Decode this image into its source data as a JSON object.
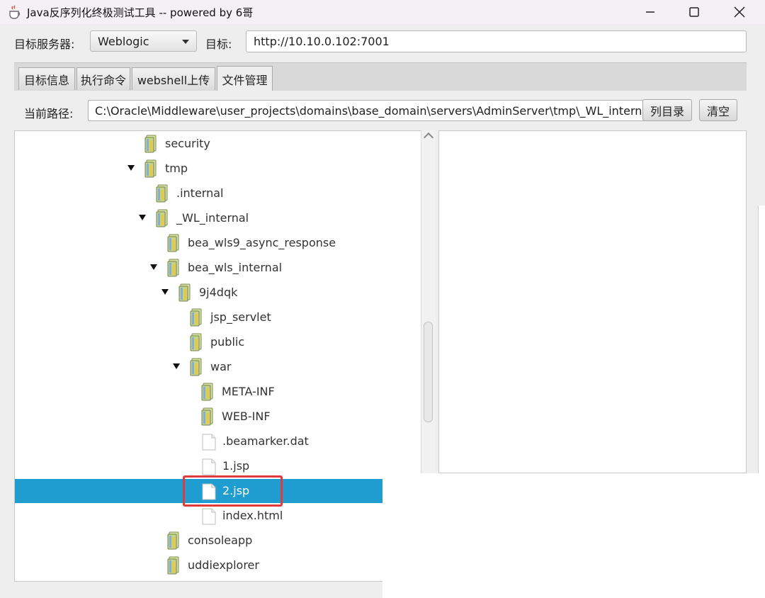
{
  "window": {
    "title": "Java反序列化终极测试工具  -- powered by 6哥"
  },
  "toolbar": {
    "server_label": "目标服务器:",
    "server_value": "Weblogic",
    "target_label": "目标:",
    "target_value": "http://10.10.0.102:7001"
  },
  "tabs": [
    {
      "label": "目标信息",
      "active": false
    },
    {
      "label": "执行命令",
      "active": false
    },
    {
      "label": "webshell上传",
      "active": false
    },
    {
      "label": "文件管理",
      "active": true
    }
  ],
  "file_manager": {
    "path_label": "当前路径:",
    "path_value": "C:\\Oracle\\Middleware\\user_projects\\domains\\base_domain\\servers\\AdminServer\\tmp\\_WL_internal",
    "list_button": "列目录",
    "clear_button": "清空"
  },
  "tree": [
    {
      "label": "security",
      "type": "folder",
      "depth": 0,
      "expanded": false
    },
    {
      "label": "tmp",
      "type": "folder",
      "depth": 0,
      "expanded": true
    },
    {
      "label": ".internal",
      "type": "folder",
      "depth": 1,
      "expanded": false
    },
    {
      "label": "_WL_internal",
      "type": "folder",
      "depth": 1,
      "expanded": true
    },
    {
      "label": "bea_wls9_async_response",
      "type": "folder",
      "depth": 2,
      "expanded": false
    },
    {
      "label": "bea_wls_internal",
      "type": "folder",
      "depth": 2,
      "expanded": true
    },
    {
      "label": "9j4dqk",
      "type": "folder",
      "depth": 3,
      "expanded": true
    },
    {
      "label": "jsp_servlet",
      "type": "folder",
      "depth": 4,
      "expanded": false
    },
    {
      "label": "public",
      "type": "folder",
      "depth": 4,
      "expanded": false
    },
    {
      "label": "war",
      "type": "folder",
      "depth": 4,
      "expanded": true
    },
    {
      "label": "META-INF",
      "type": "folder",
      "depth": 5,
      "expanded": false
    },
    {
      "label": "WEB-INF",
      "type": "folder",
      "depth": 5,
      "expanded": false
    },
    {
      "label": ".beamarker.dat",
      "type": "file",
      "depth": 5,
      "expanded": false
    },
    {
      "label": "1.jsp",
      "type": "file",
      "depth": 5,
      "expanded": false
    },
    {
      "label": "2.jsp",
      "type": "file",
      "depth": 5,
      "expanded": false,
      "selected": true
    },
    {
      "label": "index.html",
      "type": "file",
      "depth": 5,
      "expanded": false
    },
    {
      "label": "consoleapp",
      "type": "folder",
      "depth": 2,
      "expanded": false
    },
    {
      "label": "uddiexplorer",
      "type": "folder",
      "depth": 2,
      "expanded": false
    }
  ],
  "colors": {
    "selection": "#1f9dd0",
    "highlight_box": "#e03a3a"
  }
}
